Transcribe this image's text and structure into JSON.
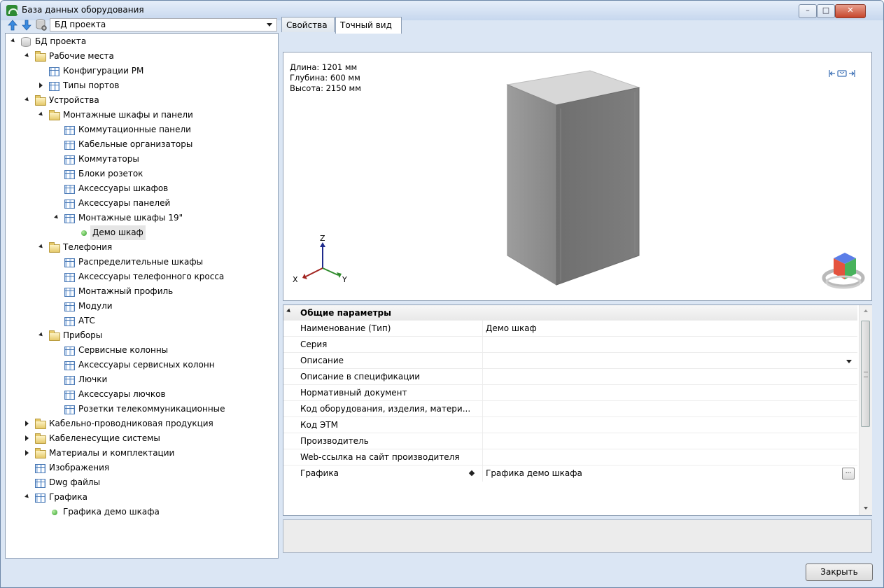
{
  "window": {
    "title": "База данных оборудования",
    "icon": "app-icon"
  },
  "left": {
    "db_select_value": "БД проекта",
    "tree": [
      {
        "label": "БД проекта",
        "icon": "database-icon",
        "expander": "open",
        "level": 0
      },
      {
        "label": "Рабочие места",
        "icon": "folder-open-icon",
        "expander": "open",
        "level": 1
      },
      {
        "label": "Конфигурации РМ",
        "icon": "table-icon",
        "expander": "none",
        "level": 2
      },
      {
        "label": "Типы портов",
        "icon": "table-icon",
        "expander": "closed",
        "level": 2
      },
      {
        "label": "Устройства",
        "icon": "folder-open-icon",
        "expander": "open",
        "level": 1
      },
      {
        "label": "Монтажные шкафы и панели",
        "icon": "folder-open-icon",
        "expander": "open",
        "level": 2
      },
      {
        "label": "Коммутационные панели",
        "icon": "table-icon",
        "expander": "none",
        "level": 3
      },
      {
        "label": "Кабельные организаторы",
        "icon": "table-icon",
        "expander": "none",
        "level": 3
      },
      {
        "label": "Коммутаторы",
        "icon": "table-icon",
        "expander": "none",
        "level": 3
      },
      {
        "label": "Блоки розеток",
        "icon": "table-icon",
        "expander": "none",
        "level": 3
      },
      {
        "label": "Аксессуары шкафов",
        "icon": "table-icon",
        "expander": "none",
        "level": 3
      },
      {
        "label": "Аксессуары панелей",
        "icon": "table-icon",
        "expander": "none",
        "level": 3
      },
      {
        "label": "Монтажные шкафы 19\"",
        "icon": "table-icon",
        "expander": "open",
        "level": 3
      },
      {
        "label": "Демо шкаф",
        "icon": "green-dot-icon",
        "expander": "none",
        "level": 4,
        "selected": true
      },
      {
        "label": "Телефония",
        "icon": "folder-open-icon",
        "expander": "open",
        "level": 2
      },
      {
        "label": "Распределительные шкафы",
        "icon": "table-icon",
        "expander": "none",
        "level": 3
      },
      {
        "label": "Аксессуары телефонного кросса",
        "icon": "table-icon",
        "expander": "none",
        "level": 3
      },
      {
        "label": "Монтажный профиль",
        "icon": "table-icon",
        "expander": "none",
        "level": 3
      },
      {
        "label": "Модули",
        "icon": "table-icon",
        "expander": "none",
        "level": 3
      },
      {
        "label": "АТС",
        "icon": "table-icon",
        "expander": "none",
        "level": 3
      },
      {
        "label": "Приборы",
        "icon": "folder-open-icon",
        "expander": "open",
        "level": 2
      },
      {
        "label": "Сервисные колонны",
        "icon": "table-icon",
        "expander": "none",
        "level": 3
      },
      {
        "label": "Аксессуары сервисных колонн",
        "icon": "table-icon",
        "expander": "none",
        "level": 3
      },
      {
        "label": "Лючки",
        "icon": "table-icon",
        "expander": "none",
        "level": 3
      },
      {
        "label": "Аксессуары лючков",
        "icon": "table-icon",
        "expander": "none",
        "level": 3
      },
      {
        "label": "Розетки телекоммуникационные",
        "icon": "table-icon",
        "expander": "none",
        "level": 3
      },
      {
        "label": "Кабельно-проводниковая продукция",
        "icon": "folder-icon",
        "expander": "closed",
        "level": 1
      },
      {
        "label": "Кабеленесущие системы",
        "icon": "folder-icon",
        "expander": "closed",
        "level": 1
      },
      {
        "label": "Материалы и комплектации",
        "icon": "folder-icon",
        "expander": "closed",
        "level": 1
      },
      {
        "label": "Изображения",
        "icon": "table-icon",
        "expander": "none",
        "level": 1
      },
      {
        "label": "Dwg файлы",
        "icon": "table-icon",
        "expander": "none",
        "level": 1
      },
      {
        "label": "Графика",
        "icon": "table-icon",
        "expander": "open",
        "level": 1
      },
      {
        "label": "Графика демо шкафа",
        "icon": "green-dot-icon",
        "expander": "none",
        "level": 2
      }
    ]
  },
  "tabs": [
    {
      "label": "Свойства",
      "active": false
    },
    {
      "label": "Точный вид",
      "active": true
    }
  ],
  "viewport": {
    "length": "Длина: 1201 мм",
    "depth": "Глубина: 600 мм",
    "height": "Высота: 2150 мм",
    "axis_x": "X",
    "axis_y": "Y",
    "axis_z": "Z"
  },
  "properties": {
    "group": "Общие параметры",
    "rows": [
      {
        "name": "Наименование (Тип)",
        "value": "Демо шкаф"
      },
      {
        "name": "Серия",
        "value": ""
      },
      {
        "name": "Описание",
        "value": "",
        "dropdown": true
      },
      {
        "name": "Описание в спецификации",
        "value": ""
      },
      {
        "name": "Нормативный документ",
        "value": ""
      },
      {
        "name": "Код оборудования, изделия, матери...",
        "value": ""
      },
      {
        "name": "Код ЭТМ",
        "value": ""
      },
      {
        "name": "Производитель",
        "value": ""
      },
      {
        "name": "Web-ссылка на сайт производителя",
        "value": ""
      },
      {
        "name": "Графика",
        "value": "Графика демо шкафа",
        "diamond": true,
        "ellipsis": "..."
      }
    ]
  },
  "buttons": {
    "close": "Закрыть"
  }
}
